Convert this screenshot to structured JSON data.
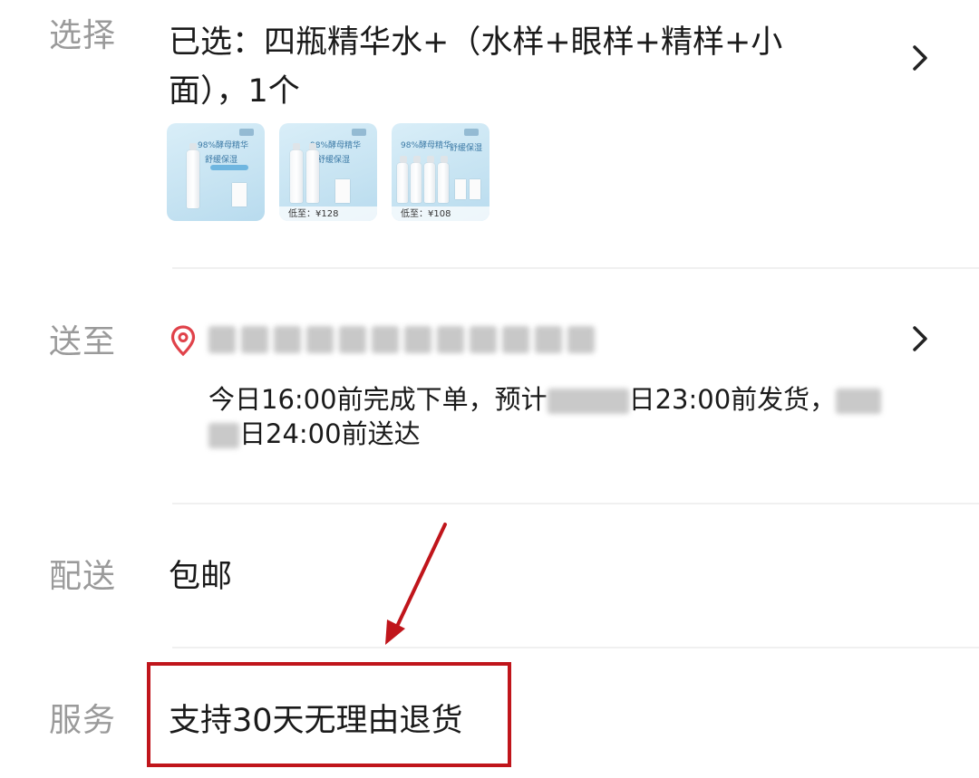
{
  "select": {
    "label": "选择",
    "value": "已选：四瓶精华水+（水样+眼样+精样+小面），1个",
    "thumbnails": [
      {
        "headline": "98%酵母精华",
        "subline": "舒缓保湿",
        "price": ""
      },
      {
        "headline": "98%酵母精华",
        "subline": "舒缓保湿",
        "price": "低至：¥128"
      },
      {
        "headline": "98%酵母精华",
        "subline": "舒缓保湿",
        "price": "低至：¥108"
      }
    ]
  },
  "deliver_to": {
    "label": "送至",
    "eta_part1": "今日16:00前完成下单，预计",
    "eta_part2": "日23:00前发货，",
    "eta_part3": "日24:00前送达"
  },
  "shipping": {
    "label": "配送",
    "value": "包邮"
  },
  "service": {
    "label": "服务",
    "value": "支持30天无理由退货"
  },
  "colors": {
    "label_gray": "#9a9a9a",
    "text_dark": "#1a1a1a",
    "location_red": "#e0424a",
    "annotation_red": "#c0151b",
    "divider": "#f0f0f0"
  },
  "icons": {
    "chevron": "chevron-right-icon",
    "location": "location-pin-icon"
  }
}
